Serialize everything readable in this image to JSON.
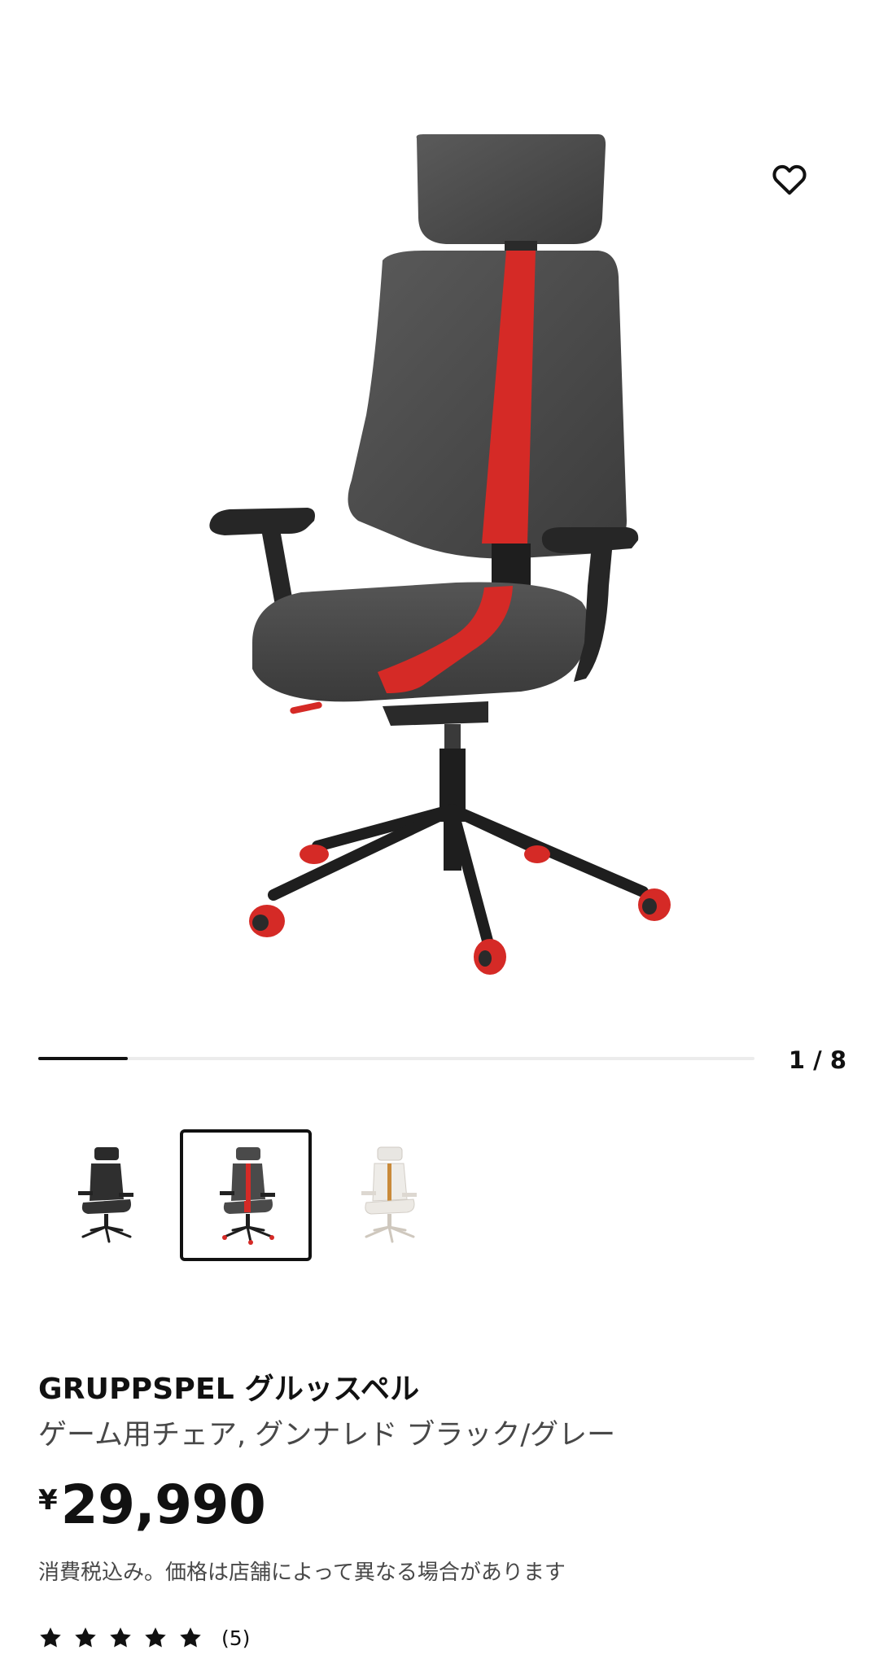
{
  "gallery": {
    "current": 1,
    "total": 8,
    "counter_text": "1 / 8",
    "progress_fraction": 0.125
  },
  "favorite": {
    "icon": "heart-outline-icon"
  },
  "thumbnails": [
    {
      "name": "black",
      "selected": false
    },
    {
      "name": "gunnared-black-grey-red",
      "selected": true
    },
    {
      "name": "white-orange",
      "selected": false
    }
  ],
  "product": {
    "name": "GRUPPSPEL グルッスペル",
    "description": "ゲーム用チェア, グンナレド ブラック/グレー",
    "currency": "¥",
    "price": "29,990",
    "tax_note": "消費税込み。価格は店舗によって異なる場合があります",
    "rating": {
      "stars": 5,
      "count_text": "(5)"
    }
  },
  "colors": {
    "accent_red": "#d52a26",
    "upholstery_grey": "#4a4a4a",
    "frame_black": "#1e1e1e",
    "text": "#111111",
    "secondary_text": "#484848"
  }
}
